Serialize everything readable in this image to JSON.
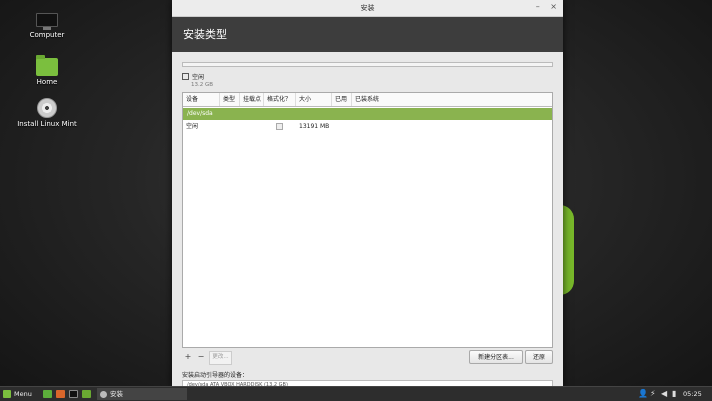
{
  "desktop": {
    "icons": [
      {
        "label": "Computer"
      },
      {
        "label": "Home"
      },
      {
        "label": "Install Linux Mint"
      }
    ]
  },
  "window": {
    "title": "安装",
    "controls": {
      "minimize": "–",
      "close": "×"
    },
    "header_title": "安装类型"
  },
  "partition_bar": {
    "legend_name": "空闲",
    "legend_size": "13.2 GB"
  },
  "table": {
    "columns": [
      "设备",
      "类型",
      "挂载点",
      "格式化？",
      "大小",
      "已用",
      "已装系统"
    ],
    "device_row": "/dev/sda",
    "rows": [
      {
        "device": "空闲",
        "type": "",
        "mount": "",
        "size": "13191 MB",
        "used": "",
        "system": ""
      }
    ]
  },
  "toolbar": {
    "add": "+",
    "remove": "−",
    "change": "更改...",
    "new_table": "新建分区表...",
    "revert": "还原"
  },
  "boot": {
    "label": "安装启动引导器的设备：",
    "value": "/dev/sda ATA VBOX HARDDISK (13.2 GB)"
  },
  "taskbar": {
    "menu_label": "Menu",
    "task_label": "安装",
    "clock": "05:25",
    "colors": {
      "mint_green": "#7bbf3e",
      "panel": "#2d2d2d"
    }
  }
}
